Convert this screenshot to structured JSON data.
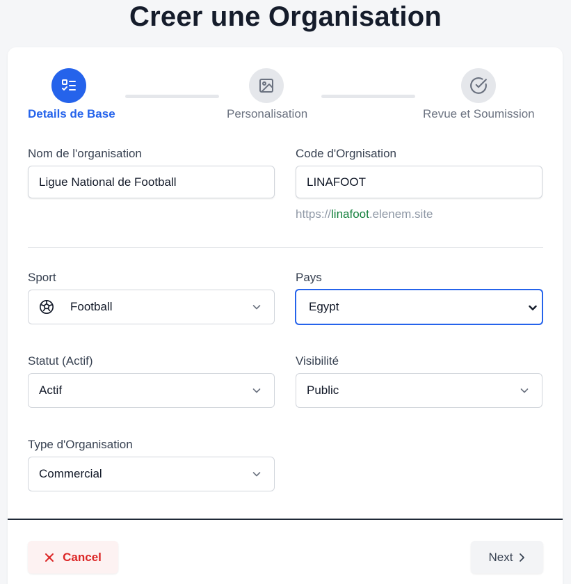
{
  "page": {
    "title": "Creer une Organisation"
  },
  "stepper": {
    "steps": [
      {
        "label": "Details de Base",
        "state": "active",
        "icon": "checklist-icon"
      },
      {
        "label": "Personalisation",
        "state": "idle",
        "icon": "image-icon"
      },
      {
        "label": "Revue et Soumission",
        "state": "idle",
        "icon": "check-circle-icon"
      }
    ]
  },
  "form": {
    "org_name": {
      "label": "Nom de l'organisation",
      "value": "Ligue National de Football"
    },
    "org_code": {
      "label": "Code d'Orgnisation",
      "value": "LINAFOOT"
    },
    "url_hint": {
      "prefix": "https://",
      "slug": "linafoot",
      "suffix": ".elenem.site"
    },
    "sport": {
      "label": "Sport",
      "value": "Football",
      "icon": "soccer-ball-icon"
    },
    "country": {
      "label": "Pays",
      "value": "Egypt"
    },
    "status": {
      "label": "Statut (Actif)",
      "value": "Actif"
    },
    "visibility": {
      "label": "Visibilité",
      "value": "Public"
    },
    "org_type": {
      "label": "Type d'Organisation",
      "value": "Commercial"
    }
  },
  "actions": {
    "cancel_label": "Cancel",
    "next_label": "Next"
  },
  "colors": {
    "accent": "#2563eb",
    "danger": "#dc2626",
    "slug": "#15803d"
  }
}
